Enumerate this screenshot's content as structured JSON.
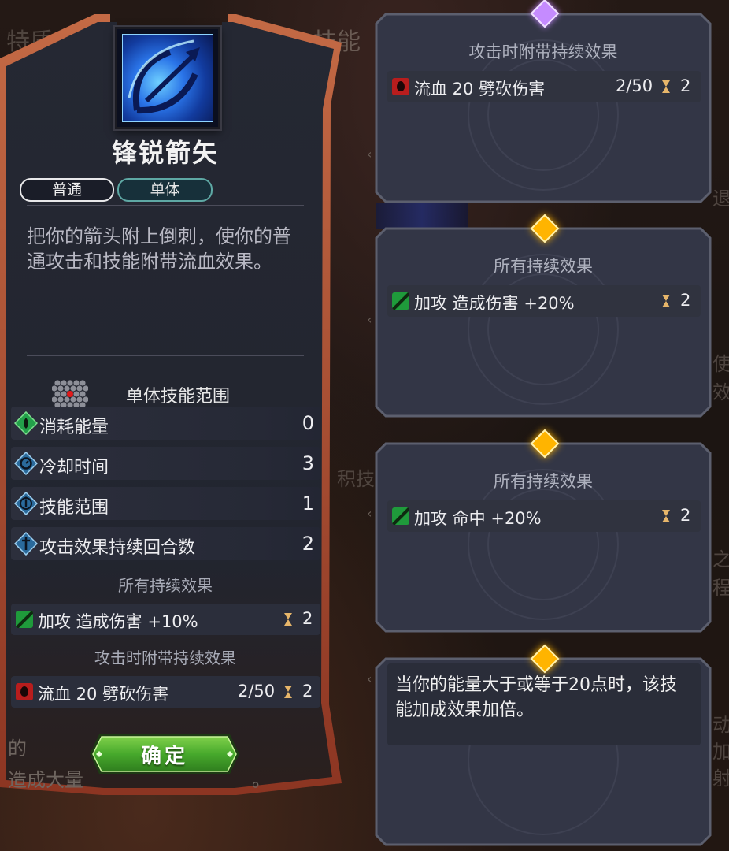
{
  "background": {
    "tab_traits": "特质",
    "tab_skills": "技能",
    "right_edge_texts": [
      "退",
      "使",
      "效",
      "之",
      "程",
      "动",
      "加",
      "射"
    ],
    "mid_text": "积技",
    "footer_fragment": "造成大量",
    "footer_fragment_prefix": "的",
    "footer_end": "。"
  },
  "skill": {
    "icon": "bow-arrow-icon",
    "name": "锋锐箭矢",
    "tags": [
      "普通",
      "单体"
    ],
    "description": "把你的箭头附上倒刺，使你的普通攻击和技能附带流血效果。",
    "range_label": "单体技能范围",
    "stats": [
      {
        "icon": "energy-drop-icon",
        "label": "消耗能量",
        "value": "0"
      },
      {
        "icon": "cooldown-clock-icon",
        "label": "冷却时间",
        "value": "3"
      },
      {
        "icon": "range-target-icon",
        "label": "技能范围",
        "value": "1"
      },
      {
        "icon": "duration-sword-icon",
        "label": "攻击效果持续回合数",
        "value": "2"
      }
    ],
    "persistent_title": "所有持续效果",
    "persistent_effect": {
      "icon": "attack-up-icon",
      "label": "加攻 造成伤害 +10%",
      "turns": "2"
    },
    "on_attack_title": "攻击时附带持续效果",
    "on_attack_effect": {
      "icon": "bleed-drop-icon",
      "label": "流血 20 劈砍伤害",
      "stack": "2/50",
      "turns": "2"
    },
    "confirm_label": "确定"
  },
  "cards": [
    {
      "gem_color": "#c58bff",
      "title": "攻击时附带持续效果",
      "row": {
        "icon": "bleed-drop-icon",
        "label": "流血 20 劈砍伤害",
        "stack": "2/50",
        "turns": "2"
      }
    },
    {
      "gem_color": "#ffb400",
      "title": "所有持续效果",
      "row": {
        "icon": "attack-up-icon",
        "label": "加攻 造成伤害 +20%",
        "turns": "2"
      }
    },
    {
      "gem_color": "#ffb400",
      "title": "所有持续效果",
      "row": {
        "icon": "attack-up-icon",
        "label": "加攻 命中 +20%",
        "turns": "2"
      }
    },
    {
      "gem_color": "#ffb400",
      "note": "当你的能量大于或等于20点时，该技能加成效果加倍。"
    }
  ],
  "colors": {
    "panel_border": "#a8452f",
    "panel_fill": "#22252f",
    "card_border": "#5c5f6e",
    "confirm_green": "#3fae2a",
    "hourglass": "#e7b66a"
  }
}
